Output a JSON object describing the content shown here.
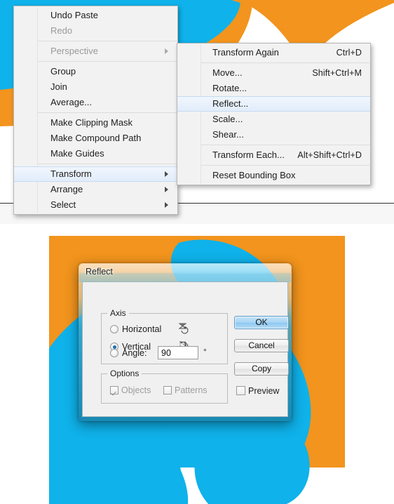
{
  "app": {
    "document_background": "#ffffff",
    "artwork_orange": "#f2941d",
    "artwork_cyan": "#0fb2ea",
    "canvas_divider_color": "#2b2b2b"
  },
  "context_menu": {
    "name": "object-context-menu",
    "items": [
      {
        "label": "Undo Paste",
        "shortcut": "",
        "disabled": false,
        "submenu": false,
        "separator_after": false
      },
      {
        "label": "Redo",
        "shortcut": "",
        "disabled": true,
        "submenu": false,
        "separator_after": true
      },
      {
        "label": "Perspective",
        "shortcut": "",
        "disabled": true,
        "submenu": true,
        "separator_after": true
      },
      {
        "label": "Group",
        "shortcut": "",
        "disabled": false,
        "submenu": false,
        "separator_after": false
      },
      {
        "label": "Join",
        "shortcut": "",
        "disabled": false,
        "submenu": false,
        "separator_after": false
      },
      {
        "label": "Average...",
        "shortcut": "",
        "disabled": false,
        "submenu": false,
        "separator_after": true
      },
      {
        "label": "Make Clipping Mask",
        "shortcut": "",
        "disabled": false,
        "submenu": false,
        "separator_after": false
      },
      {
        "label": "Make Compound Path",
        "shortcut": "",
        "disabled": false,
        "submenu": false,
        "separator_after": false
      },
      {
        "label": "Make Guides",
        "shortcut": "",
        "disabled": false,
        "submenu": false,
        "separator_after": true
      },
      {
        "label": "Transform",
        "shortcut": "",
        "disabled": false,
        "submenu": true,
        "separator_after": false,
        "highlighted": true
      },
      {
        "label": "Arrange",
        "shortcut": "",
        "disabled": false,
        "submenu": true,
        "separator_after": false
      },
      {
        "label": "Select",
        "shortcut": "",
        "disabled": false,
        "submenu": true,
        "separator_after": false
      }
    ]
  },
  "transform_submenu": {
    "name": "transform-submenu",
    "items": [
      {
        "label": "Transform Again",
        "shortcut": "Ctrl+D",
        "separator_after": true
      },
      {
        "label": "Move...",
        "shortcut": "Shift+Ctrl+M",
        "separator_after": false
      },
      {
        "label": "Rotate...",
        "shortcut": "",
        "separator_after": false
      },
      {
        "label": "Reflect...",
        "shortcut": "",
        "separator_after": false,
        "highlighted": true
      },
      {
        "label": "Scale...",
        "shortcut": "",
        "separator_after": false
      },
      {
        "label": "Shear...",
        "shortcut": "",
        "separator_after": true
      },
      {
        "label": "Transform Each...",
        "shortcut": "Alt+Shift+Ctrl+D",
        "separator_after": true
      },
      {
        "label": "Reset Bounding Box",
        "shortcut": "",
        "separator_after": false
      }
    ]
  },
  "reflect_dialog": {
    "title": "Reflect",
    "axis_group_label": "Axis",
    "options_group_label": "Options",
    "radios": [
      {
        "label": "Horizontal",
        "checked": false,
        "icon": "flip-horizontal-icon"
      },
      {
        "label": "Vertical",
        "checked": true,
        "icon": "flip-vertical-icon"
      }
    ],
    "angle": {
      "label": "Angle:",
      "checked": false,
      "value": "90",
      "unit": "°"
    },
    "options": [
      {
        "label": "Objects",
        "checked": true,
        "disabled": true
      },
      {
        "label": "Patterns",
        "checked": false,
        "disabled": true
      }
    ],
    "buttons": {
      "ok": "OK",
      "cancel": "Cancel",
      "copy": "Copy"
    },
    "preview": {
      "label": "Preview",
      "checked": false
    }
  }
}
